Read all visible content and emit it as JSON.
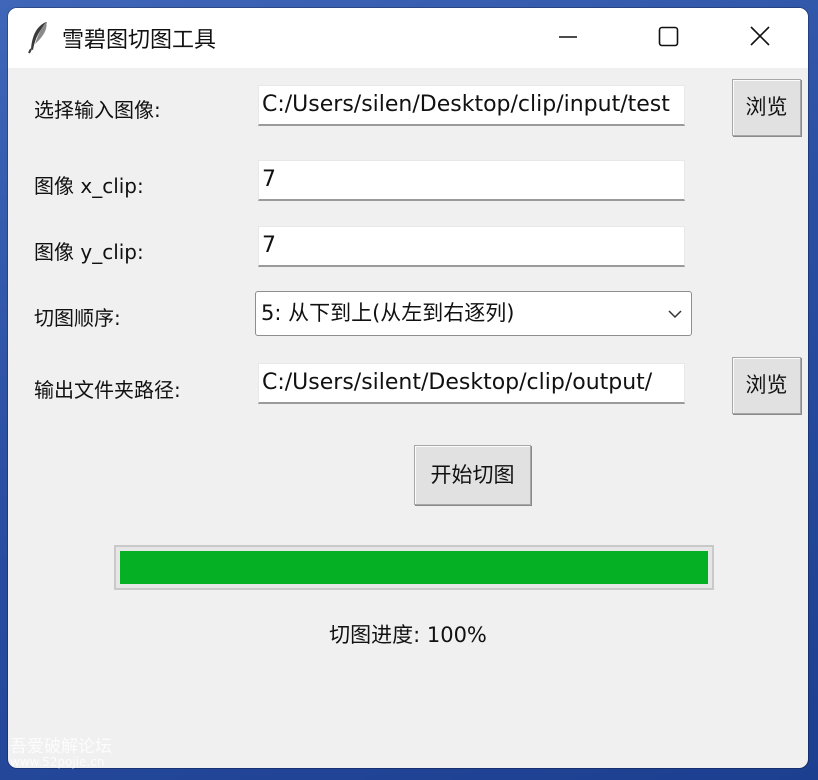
{
  "window": {
    "title": "雪碧图切图工具"
  },
  "form": {
    "input_label": "选择输入图像:",
    "input_value": "C:/Users/silen/Desktop/clip/input/test",
    "browse_label": "浏览",
    "x_clip_label": "图像 x_clip:",
    "x_clip_value": "7",
    "y_clip_label": "图像 y_clip:",
    "y_clip_value": "7",
    "order_label": "切图顺序:",
    "order_value": "5: 从下到上(从左到右逐列)",
    "output_label": "输出文件夹路径:",
    "output_value": "C:/Users/silent/Desktop/clip/output/",
    "output_browse_label": "浏览",
    "start_label": "开始切图"
  },
  "progress": {
    "percent": 100,
    "status_text": "切图进度: 100%",
    "color": "#06b025"
  },
  "watermark": {
    "line1": "吾爱破解论坛",
    "line2": "www.52pojie.cn"
  },
  "icons": {
    "app": "feather-icon",
    "minimize": "minimize-icon",
    "maximize": "maximize-icon",
    "close": "close-icon",
    "dropdown": "chevron-down-icon"
  }
}
